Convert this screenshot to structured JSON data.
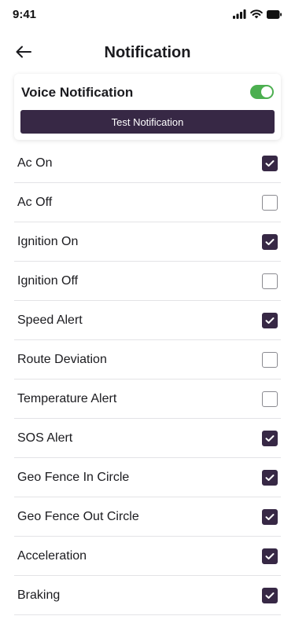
{
  "status_bar": {
    "time": "9:41",
    "icons": [
      "signal-icon",
      "wifi-icon",
      "battery-icon"
    ]
  },
  "header": {
    "back_icon": "arrow-left-icon",
    "title": "Notification"
  },
  "voice": {
    "label": "Voice Notification",
    "enabled": true,
    "toggle_color": "#4caf50",
    "test_button_label": "Test Notification",
    "test_button_color": "#372845"
  },
  "notifications": [
    {
      "label": "Ac On",
      "checked": true
    },
    {
      "label": "Ac Off",
      "checked": false
    },
    {
      "label": "Ignition On",
      "checked": true
    },
    {
      "label": "Ignition Off",
      "checked": false
    },
    {
      "label": "Speed Alert",
      "checked": true
    },
    {
      "label": "Route Deviation",
      "checked": false
    },
    {
      "label": "Temperature Alert",
      "checked": false
    },
    {
      "label": "SOS Alert",
      "checked": true
    },
    {
      "label": "Geo Fence In Circle",
      "checked": true
    },
    {
      "label": "Geo Fence Out Circle",
      "checked": true
    },
    {
      "label": "Acceleration",
      "checked": true
    },
    {
      "label": "Braking",
      "checked": true
    }
  ],
  "colors": {
    "accent": "#372845",
    "divider": "#e3e3e6"
  }
}
